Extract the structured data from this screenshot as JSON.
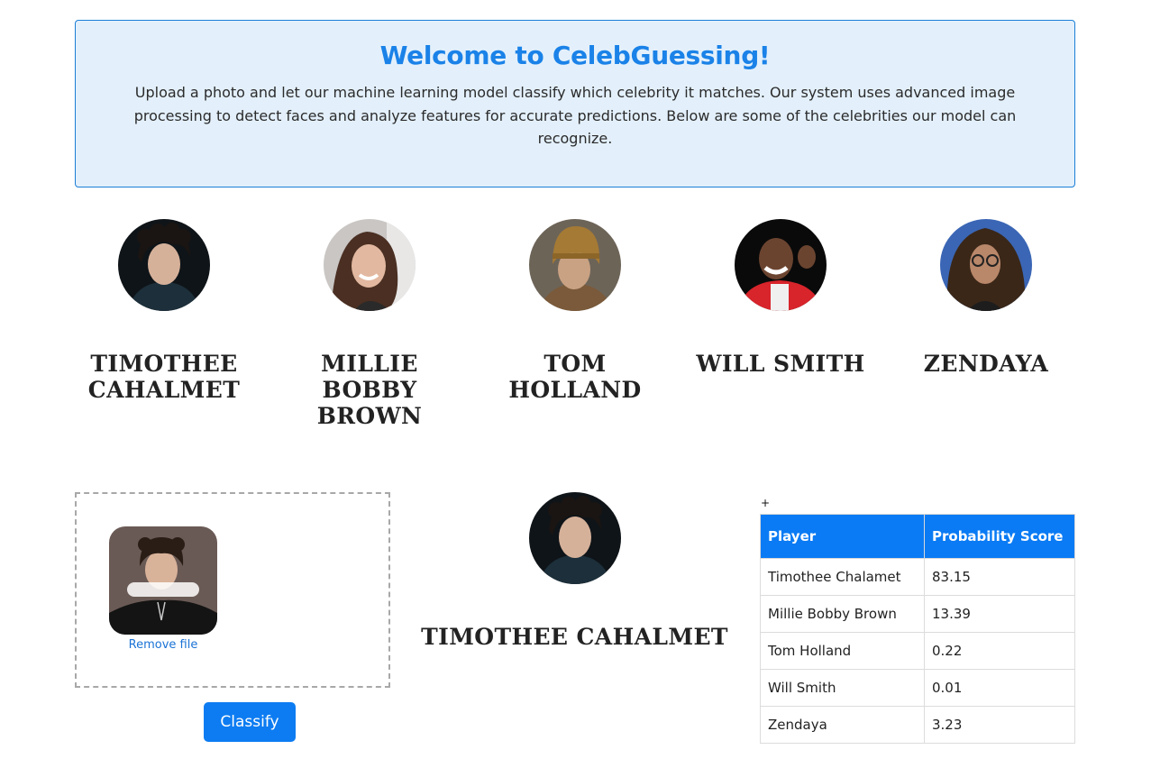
{
  "welcome": {
    "title": "Welcome to CelebGuessing!",
    "description": "Upload a photo and let our machine learning model classify which celebrity it matches. Our system uses advanced image processing to detect faces and analyze features for accurate predictions. Below are some of the celebrities our model can recognize."
  },
  "celebrities": [
    {
      "name": "TIMOTHEE CAHALMET"
    },
    {
      "name": "MILLIE BOBBY BROWN"
    },
    {
      "name": "TOM HOLLAND"
    },
    {
      "name": "WILL SMITH"
    },
    {
      "name": "ZENDAYA"
    }
  ],
  "upload": {
    "remove_label": "Remove file",
    "classify_label": "Classify"
  },
  "result": {
    "name": "TIMOTHEE CAHALMET"
  },
  "table": {
    "marker": "+",
    "headers": [
      "Player",
      "Probability Score"
    ],
    "rows": [
      [
        "Timothee Chalamet",
        "83.15"
      ],
      [
        "Millie Bobby Brown",
        "13.39"
      ],
      [
        "Tom Holland",
        "0.22"
      ],
      [
        "Will Smith",
        "0.01"
      ],
      [
        "Zendaya",
        "3.23"
      ]
    ]
  },
  "colors": {
    "accent": "#0d7cf2",
    "title": "#1a82e8",
    "panel_bg": "#e3f0fb"
  }
}
